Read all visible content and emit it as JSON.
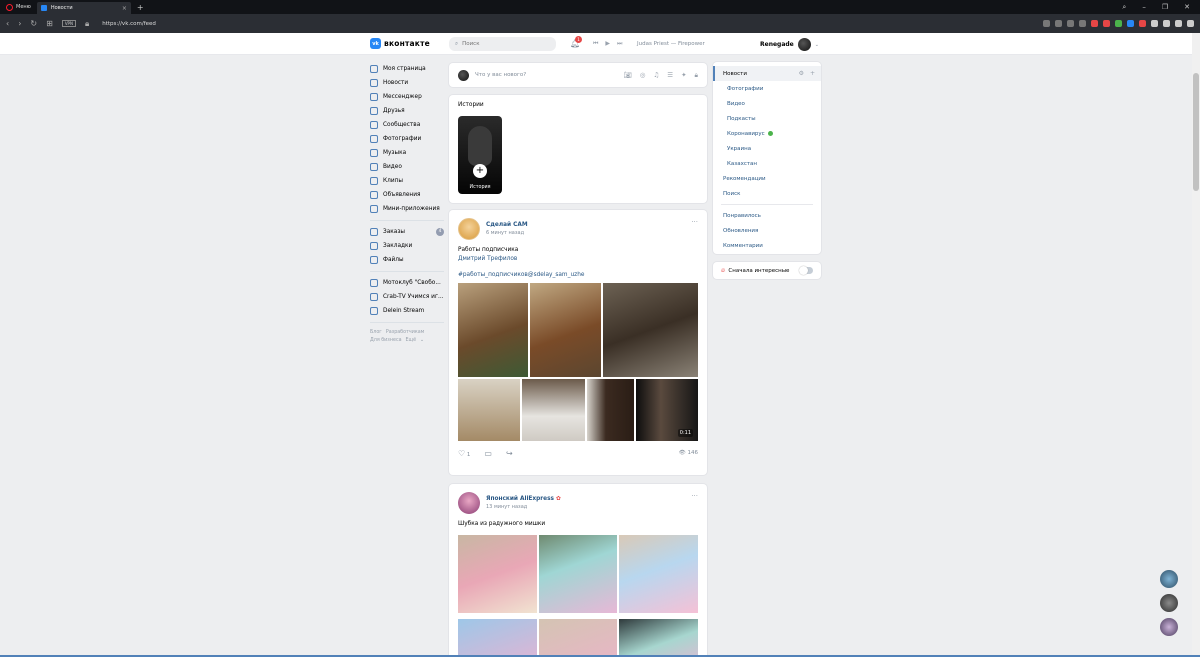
{
  "browser": {
    "menu_label": "Меню",
    "tab_title": "Новости",
    "vpn": "VPN",
    "url": "https://vk.com/feed"
  },
  "header": {
    "logo": "вконтакте",
    "search_placeholder": "Поиск",
    "notifications": "1",
    "track": "Judas Priest — Firepower",
    "username": "Renegade"
  },
  "leftnav": {
    "items": [
      {
        "label": "Моя страница"
      },
      {
        "label": "Новости"
      },
      {
        "label": "Мессенджер"
      },
      {
        "label": "Друзья"
      },
      {
        "label": "Сообщества"
      },
      {
        "label": "Фотографии"
      },
      {
        "label": "Музыка"
      },
      {
        "label": "Видео"
      },
      {
        "label": "Клипы"
      },
      {
        "label": "Объявления"
      },
      {
        "label": "Мини-приложения"
      }
    ],
    "items2": [
      {
        "label": "Заказы",
        "count": "4"
      },
      {
        "label": "Закладки"
      },
      {
        "label": "Файлы"
      }
    ],
    "items3": [
      {
        "label": "Мотоклуб \"Свобо..."
      },
      {
        "label": "Crab-TV Учимся иг..."
      },
      {
        "label": "Delein Stream"
      }
    ],
    "footer": [
      "Блог",
      "Разработчикам",
      "Для бизнеса",
      "Ещё"
    ]
  },
  "compose": {
    "placeholder": "Что у вас нового?"
  },
  "stories": {
    "title": "Истории",
    "item_label": "История"
  },
  "post1": {
    "author": "Сделай САМ",
    "time": "6 минут назад",
    "line1": "Работы подписчика",
    "line2": "Дмитрий Трефилов",
    "hashtag": "#работы_подписчиков@sdelay_sam_uzhe",
    "video_len": "0:11",
    "likes": "1",
    "views": "146"
  },
  "post2": {
    "author": "Японский AliExpress",
    "time": "13 минут назад",
    "text": "Шубка из радужного мишки"
  },
  "rightmenu": {
    "news": "Новости",
    "subs": [
      "Фотографии",
      "Видео",
      "Подкасты",
      "Коронавирус",
      "Украина",
      "Казахстан"
    ],
    "more": [
      "Рекомендации",
      "Поиск"
    ],
    "more2": [
      "Понравилось",
      "Обновления",
      "Комментарии"
    ],
    "interesting": "Сначала интересные"
  }
}
